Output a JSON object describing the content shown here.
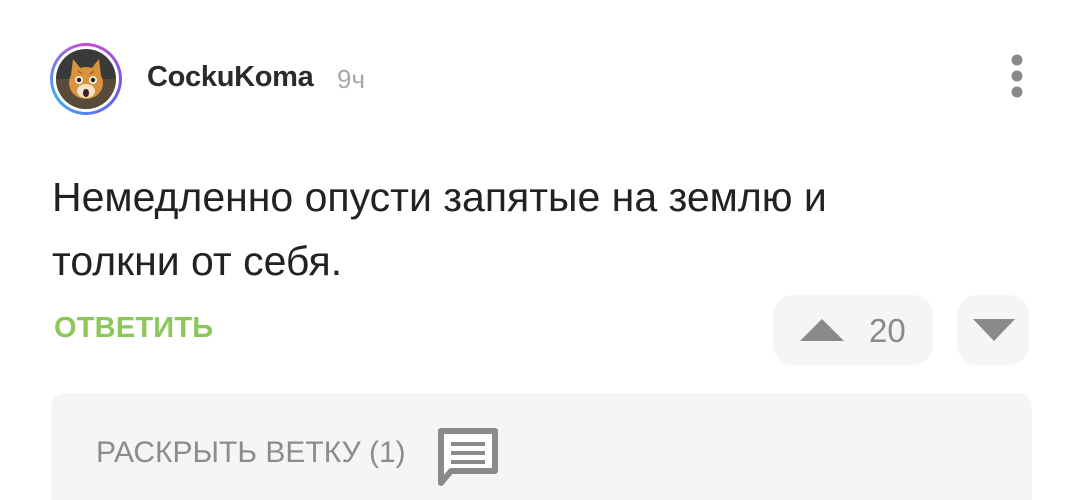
{
  "comment": {
    "author": "CockuKoma",
    "time_ago": "9ч",
    "text": "Немедленно опусти запятые на землю и толкни от себя.",
    "reply_label": "ОТВЕТИТЬ",
    "rating": "20",
    "thread_label": "РАСКРЫТЬ ВЕТКУ (1)"
  },
  "colors": {
    "reply_accent": "#8ac858",
    "vote_bg": "#f4f5f7",
    "icon_gray": "#8a8a8a"
  },
  "icons": {
    "more": "three-dots-vertical-icon",
    "upvote": "triangle-up-icon",
    "downvote": "triangle-down-icon",
    "thread": "comment-bubble-icon"
  }
}
